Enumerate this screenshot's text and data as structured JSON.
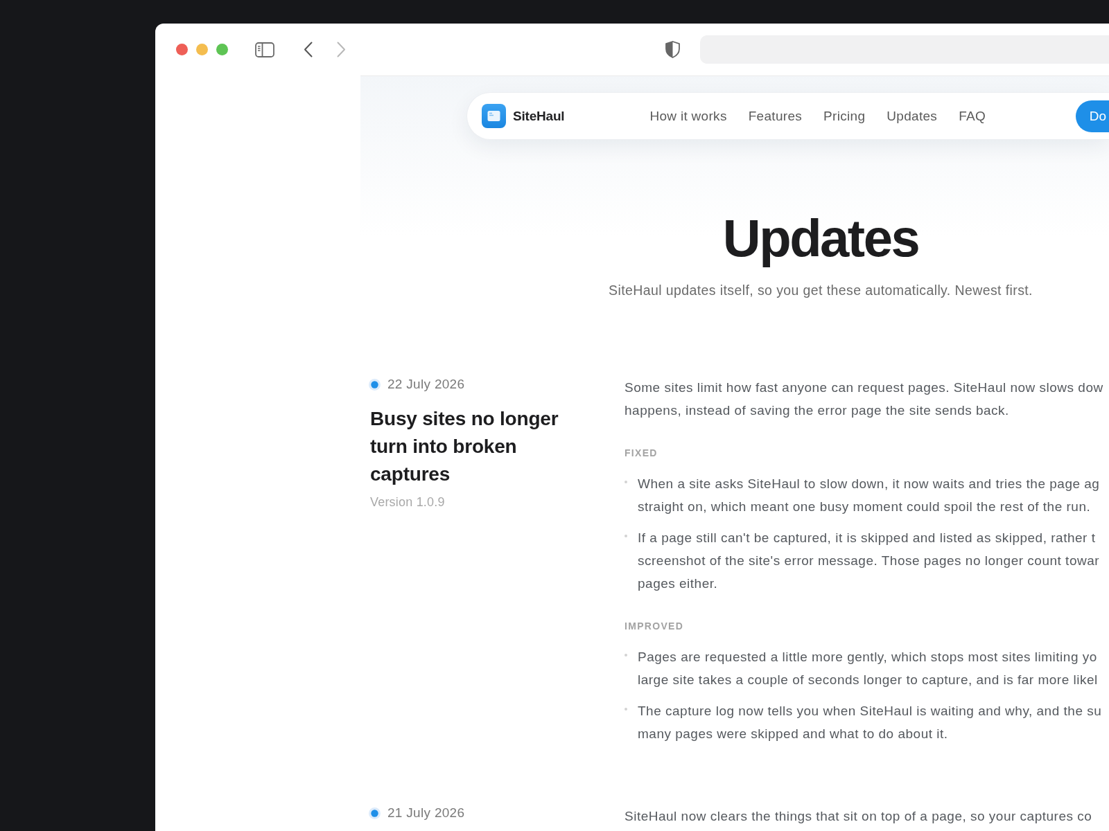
{
  "toolbar": {
    "back": {
      "disabled": false
    },
    "forward": {
      "disabled": true
    }
  },
  "nav": {
    "brand": "SiteHaul",
    "links": [
      "How it works",
      "Features",
      "Pricing",
      "Updates",
      "FAQ"
    ],
    "cta": "Do"
  },
  "hero": {
    "title": "Updates",
    "subtitle": "SiteHaul updates itself, so you get these automatically. Newest first."
  },
  "entries": [
    {
      "date": "22 July 2026",
      "title": "Busy sites no longer turn into broken captures",
      "version": "Version 1.0.9",
      "summary": [
        "Some sites limit how fast anyone can request pages. SiteHaul now slows dow",
        "happens, instead of saving the error page the site sends back."
      ],
      "sections": [
        {
          "heading": "FIXED",
          "items": [
            {
              "lines": [
                "When a site asks SiteHaul to slow down, it now waits and tries the page ag",
                "straight on, which meant one busy moment could spoil the rest of the run."
              ]
            },
            {
              "lines": [
                "If a page still can't be captured, it is skipped and listed as skipped, rather t",
                "screenshot of the site's error message. Those pages no longer count towar",
                "pages either."
              ]
            }
          ]
        },
        {
          "heading": "IMPROVED",
          "items": [
            {
              "lines": [
                "Pages are requested a little more gently, which stops most sites limiting yo",
                "large site takes a couple of seconds longer to capture, and is far more likel"
              ]
            },
            {
              "lines": [
                "The capture log now tells you when SiteHaul is waiting and why, and the su",
                "many pages were skipped and what to do about it."
              ]
            }
          ]
        }
      ]
    },
    {
      "date": "21 July 2026",
      "summary": [
        "SiteHaul now clears the things that sit on top of a page, so your captures co"
      ]
    }
  ]
}
